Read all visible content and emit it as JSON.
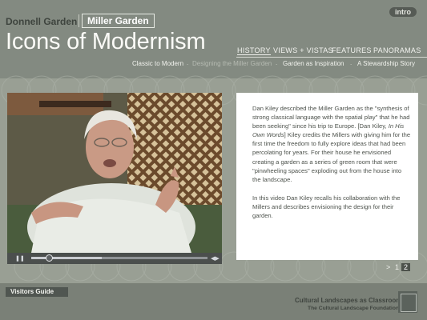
{
  "site_tabs": {
    "donnell": "Donnell Garden",
    "miller": "Miller Garden"
  },
  "page_title": "Icons of Modernism",
  "intro_button": "intro",
  "main_nav": [
    "HISTORY",
    "VIEWS + VISTAS",
    "FEATURES",
    "PANORAMAS"
  ],
  "sub_nav": {
    "items": [
      "Classic to Modern",
      "Designing the Miller Garden",
      "Garden as Inspiration",
      "A Stewardship Story"
    ],
    "separator": "."
  },
  "video": {
    "progress": 0.1,
    "buffered": 0.4,
    "play_icon": "play-pause-icon",
    "colors": {
      "frame": "#5f5a45",
      "controls": "#4b4f4d"
    }
  },
  "text_panel": {
    "paragraph1_a": "Dan Kiley described the Miller Garden as the \"synthesis of strong classical language with the spatial play\" that he had been seeking\" since his trip to Europe. [Dan Kiley, ",
    "paragraph1_em": "In His Own Words",
    "paragraph1_b": "] Kiley credits the Millers with giving him for the first time the freedom to fully explore ideas that had been percolating for years. For their house he envisioned creating a garden as a series of green room that were \"pinwheeling spaces\" exploding out from the house into the landscape.",
    "paragraph2": "In this video Dan Kiley  recalls his collaboration with the Millers and describes envisioning the design for their garden."
  },
  "pager": {
    "arrow": ">",
    "pages": [
      "1",
      "2"
    ],
    "current": "2"
  },
  "footer": {
    "visitors_guide": "Visitors Guide",
    "title": "Cultural Landscapes as Classrooms",
    "subtitle": "The Cultural Landscape Foundation",
    "logo_icon": "foundation-logo-icon"
  },
  "colors": {
    "header": "#838a81",
    "body": "#999f94",
    "footer": "#7a8077",
    "panel": "#ffffff"
  }
}
